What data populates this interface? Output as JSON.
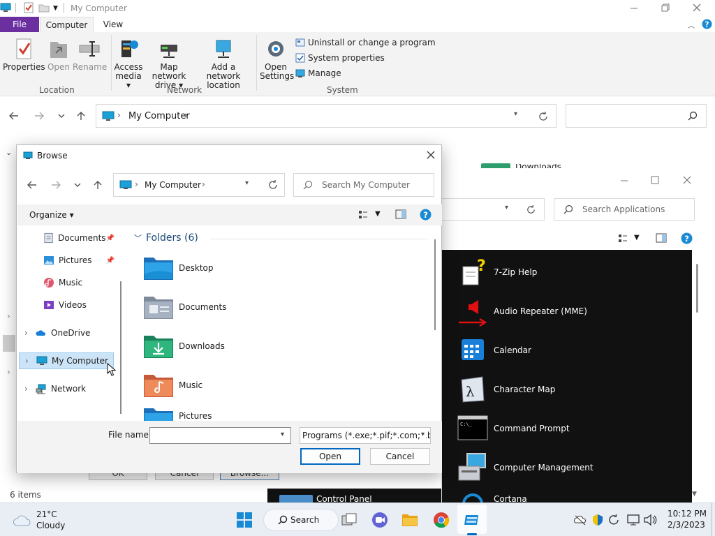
{
  "explorer": {
    "title": "My Computer",
    "tabs": {
      "file": "File",
      "computer": "Computer",
      "view": "View"
    },
    "ribbon": {
      "location": {
        "label": "Location",
        "properties": "Properties",
        "open": "Open",
        "rename": "Rename"
      },
      "network": {
        "label": "Network",
        "access_media_1": "Access",
        "access_media_2": "media ▾",
        "map_drive_1": "Map network",
        "map_drive_2": "drive ▾",
        "add_location_1": "Add a network",
        "add_location_2": "location"
      },
      "system": {
        "label": "System",
        "open_settings_1": "Open",
        "open_settings_2": "Settings",
        "uninstall": "Uninstall or change a program",
        "system_properties": "System properties",
        "manage": "Manage"
      }
    },
    "address": {
      "crumb": "My Computer"
    },
    "status": "6 items"
  },
  "apps_window": {
    "search_placeholder": "Search Applications",
    "partial_title": "Downloads",
    "items": [
      "7-Zip Help",
      "Audio Repeater (MME)",
      "Calendar",
      "Character Map",
      "Command Prompt",
      "Computer Management",
      "Cortana"
    ],
    "partial_item": "Control Panel"
  },
  "old_dialog": {
    "ok": "OK",
    "cancel": "Cancel",
    "browse": "Browse..."
  },
  "browse": {
    "title": "Browse",
    "address_crumb": "My Computer",
    "search_placeholder": "Search My Computer",
    "organize": "Organize ▾",
    "tree": [
      "Documents",
      "Pictures",
      "Music",
      "Videos",
      "OneDrive",
      "My Computer",
      "Network"
    ],
    "folders_header": "Folders (6)",
    "folders": [
      "Desktop",
      "Documents",
      "Downloads",
      "Music",
      "Pictures"
    ],
    "file_name_label": "File name:",
    "file_name_value": "",
    "file_type": "Programs (*.exe;*.pif;*.com;*.ba",
    "open_button": "Open",
    "cancel_button": "Cancel"
  },
  "taskbar": {
    "weather_temp": "21°C",
    "weather_desc": "Cloudy",
    "search_label": "Search",
    "time": "10:12 PM",
    "date": "2/3/2023"
  },
  "colors": {
    "file_tab": "#6b2fa0",
    "accent": "#0067c0",
    "help": "#1a8ad4"
  }
}
